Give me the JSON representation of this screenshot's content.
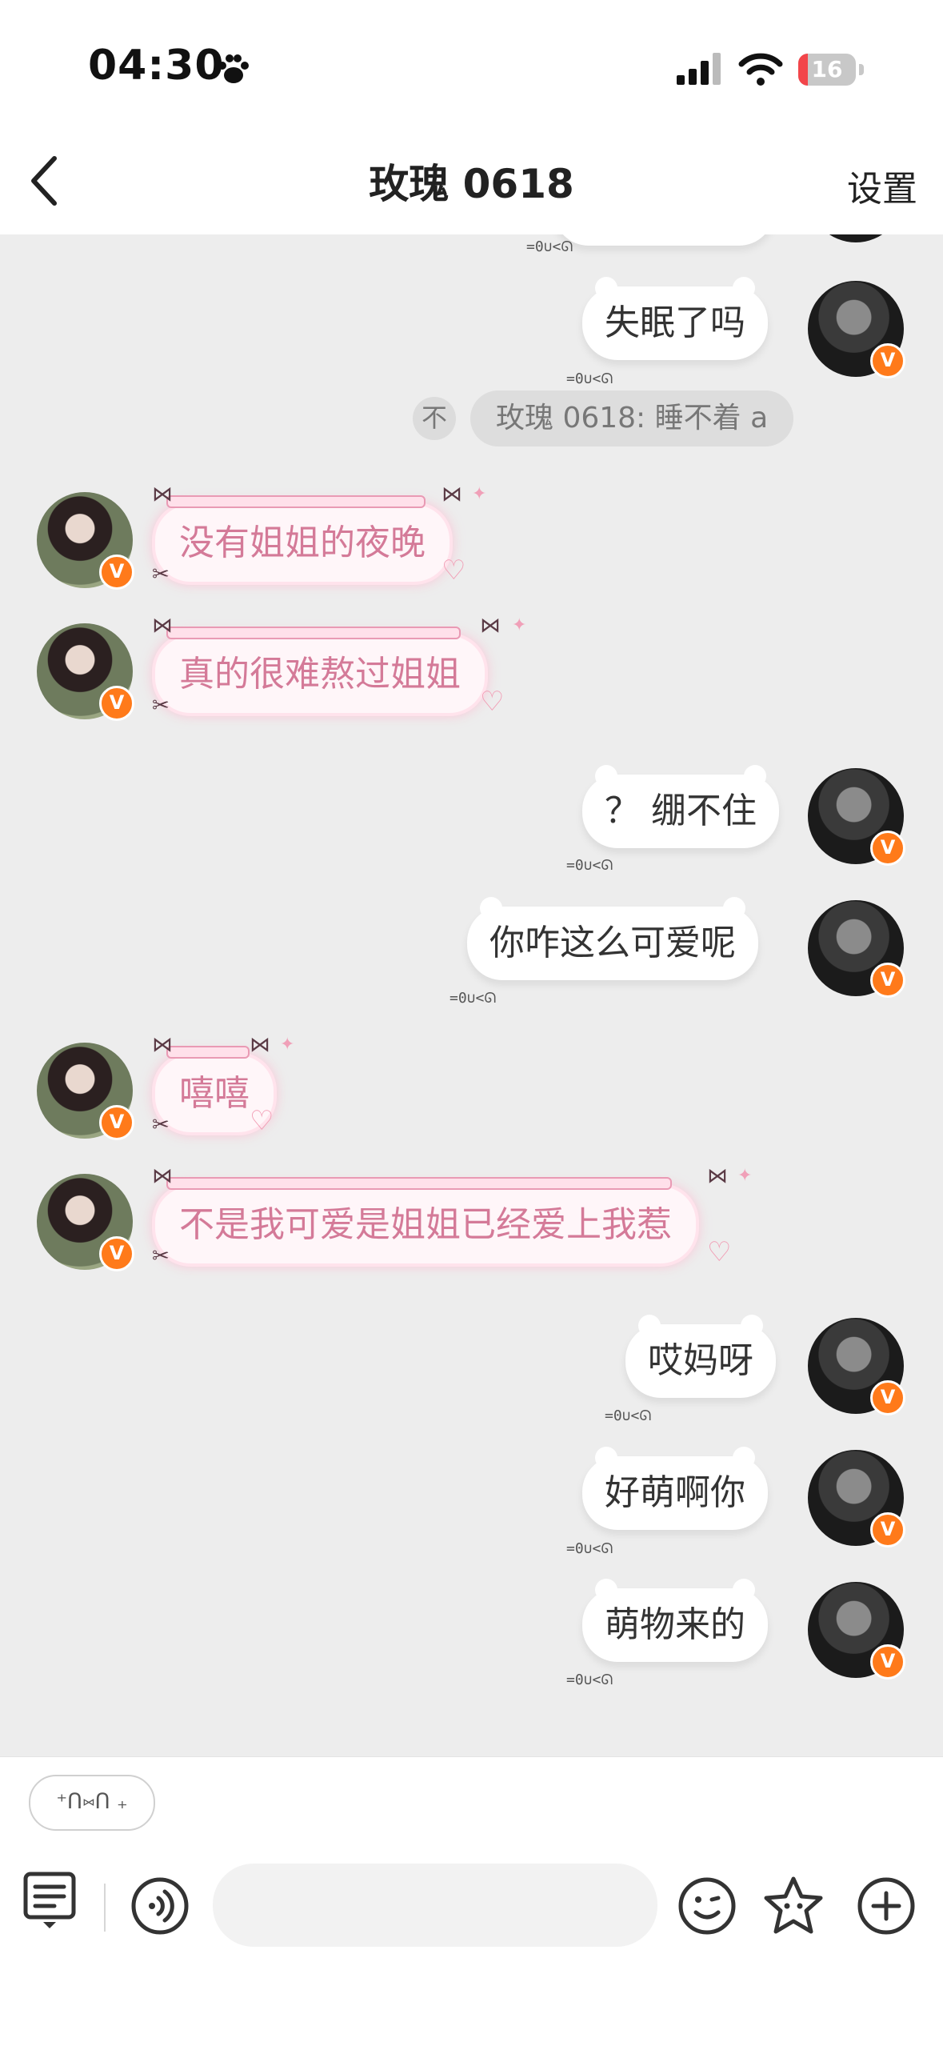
{
  "status_bar": {
    "time": "04:30",
    "battery_level": "16",
    "battery_fraction": 0.16,
    "battery_color": "#f2454a"
  },
  "nav": {
    "title": "玫瑰 0618",
    "settings_label": "设置"
  },
  "chat": {
    "tail_text": "=0∪<ᘏ",
    "pinned": {
      "icon_text": "不",
      "text": "玫瑰 0618: 睡不着 a"
    },
    "messages": [
      {
        "side": "me",
        "text": "失眠了吗"
      },
      {
        "side": "them",
        "text": "没有姐姐的夜晚"
      },
      {
        "side": "them",
        "text": "真的很难熬过姐姐"
      },
      {
        "side": "me",
        "text": "？ 绷不住"
      },
      {
        "side": "me",
        "text": "你咋这么可爱呢"
      },
      {
        "side": "them",
        "text": "嘻嘻"
      },
      {
        "side": "them",
        "text": "不是我可爱是姐姐已经爱上我惹"
      },
      {
        "side": "me",
        "text": "哎妈呀"
      },
      {
        "side": "me",
        "text": "好萌啊你"
      },
      {
        "side": "me",
        "text": "萌物来的"
      }
    ],
    "badge_letter": "V"
  },
  "input": {
    "quick_reply": "⁺ᑎ⑅ᑎ ₊",
    "placeholder": "",
    "icons": [
      "keyboard-list-icon",
      "voice-icon",
      "emoji-icon",
      "sticker-icon",
      "plus-icon"
    ]
  },
  "colors": {
    "accent": "#ff7a1a",
    "pink_text": "#d47a98",
    "background": "#ededed"
  }
}
